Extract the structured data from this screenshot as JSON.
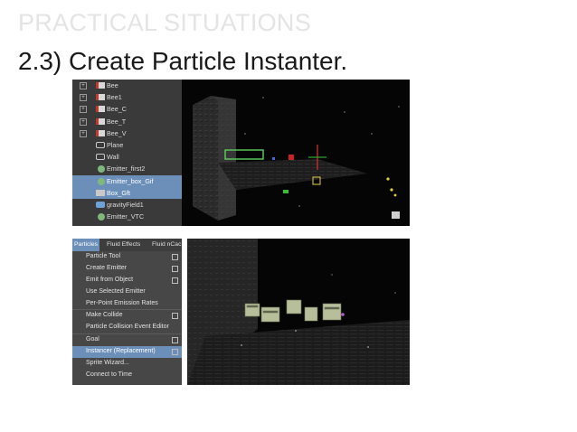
{
  "slide": {
    "kicker": "PRACTICAL SITUATIONS",
    "title": "2.3) Create Particle Instanter."
  },
  "outliner": {
    "items": [
      {
        "label": "Bee",
        "icon": "bee-icon",
        "expandable": true,
        "selected": false
      },
      {
        "label": "Bee1",
        "icon": "bee-icon",
        "expandable": true,
        "selected": false
      },
      {
        "label": "Bee_C",
        "icon": "bee-icon",
        "expandable": true,
        "selected": false
      },
      {
        "label": "Bee_T",
        "icon": "bee-icon",
        "expandable": true,
        "selected": false
      },
      {
        "label": "Bee_V",
        "icon": "bee-icon",
        "expandable": true,
        "selected": false
      },
      {
        "label": "Plane",
        "icon": "shape-icon",
        "expandable": false,
        "selected": false
      },
      {
        "label": "Wall",
        "icon": "shape-icon",
        "expandable": false,
        "selected": false
      },
      {
        "label": "Emitter_first2",
        "icon": "emitter-icon",
        "expandable": false,
        "selected": false
      },
      {
        "label": "Emitter_box_Gif",
        "icon": "emitter-icon",
        "expandable": false,
        "selected": true
      },
      {
        "label": "Box_Gft",
        "icon": "box-icon",
        "expandable": false,
        "selected": true
      },
      {
        "label": "gravityField1",
        "icon": "gravity-field-icon",
        "expandable": false,
        "selected": false
      },
      {
        "label": "Emitter_VTC",
        "icon": "emitter-icon",
        "expandable": false,
        "selected": false
      }
    ]
  },
  "menu": {
    "bar": [
      "Particles",
      "Fluid Effects",
      "Fluid nCac"
    ],
    "items": [
      {
        "label": "Particle Tool",
        "option": true,
        "highlighted": false
      },
      {
        "label": "Create Emitter",
        "option": true,
        "highlighted": false
      },
      {
        "label": "Emit from Object",
        "option": true,
        "highlighted": false
      },
      {
        "label": "Use Selected Emitter",
        "option": false,
        "highlighted": false
      },
      {
        "label": "Per-Point Emission Rates",
        "option": false,
        "highlighted": false
      },
      {
        "label": "Make Collide",
        "option": true,
        "highlighted": false
      },
      {
        "label": "Particle Collision Event Editor",
        "option": false,
        "highlighted": false
      },
      {
        "label": "Goal",
        "option": true,
        "highlighted": false
      },
      {
        "label": "Instancer (Replacement)",
        "option": true,
        "highlighted": true
      },
      {
        "label": "Sprite Wizard...",
        "option": false,
        "highlighted": false
      },
      {
        "label": "Connect to Time",
        "option": false,
        "highlighted": false
      }
    ]
  },
  "colors": {
    "selection": "#6b8fb8",
    "panel": "#3a3a3a",
    "viewport": "#050505"
  }
}
